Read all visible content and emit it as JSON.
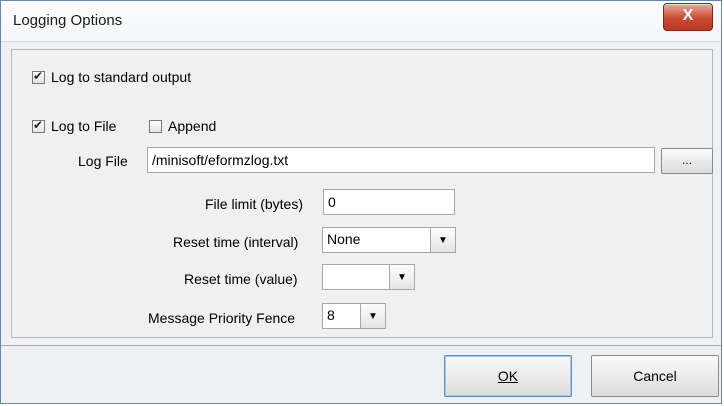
{
  "window": {
    "title": "Logging Options",
    "close_glyph": "X"
  },
  "log_stdout": {
    "label": "Log to standard output",
    "checked": true
  },
  "log_file_toggle": {
    "label": "Log to File",
    "checked": true
  },
  "append": {
    "label": "Append",
    "checked": false
  },
  "log_file": {
    "label": "Log File",
    "value": "/minisoft/eformzlog.txt",
    "browse_label": "..."
  },
  "file_limit": {
    "label": "File limit (bytes)",
    "value": "0"
  },
  "reset_interval": {
    "label": "Reset time (interval)",
    "value": "None"
  },
  "reset_value": {
    "label": "Reset time (value)",
    "value": ""
  },
  "priority_fence": {
    "label": "Message Priority Fence",
    "value": "8"
  },
  "buttons": {
    "ok": "OK",
    "cancel": "Cancel"
  },
  "icons": {
    "dropdown": "chevron-down-icon",
    "close": "close-icon",
    "check": "checkmark-icon"
  }
}
